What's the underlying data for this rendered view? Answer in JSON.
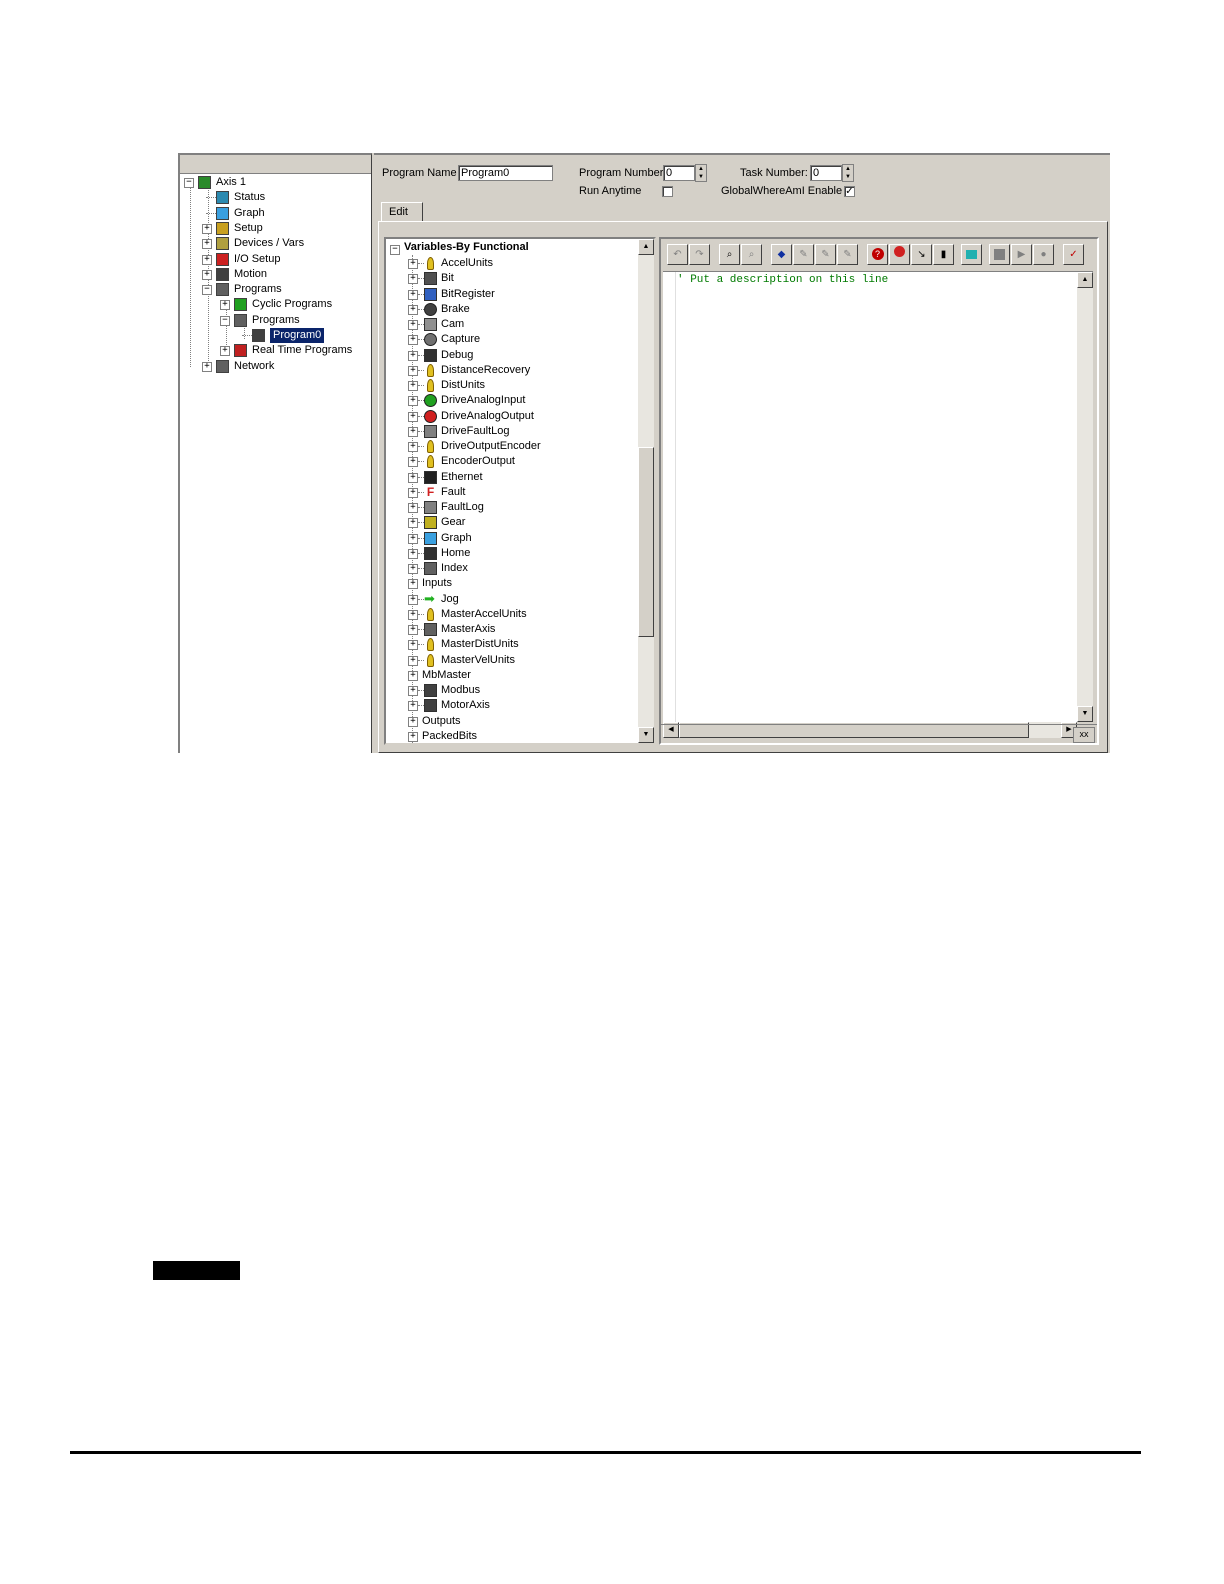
{
  "nav": {
    "items": [
      {
        "label": "Axis 1",
        "icon": "drive-icon",
        "expander": "−"
      },
      {
        "label": "Status",
        "icon": "status-icon",
        "expander": ""
      },
      {
        "label": "Graph",
        "icon": "graph-icon",
        "expander": ""
      },
      {
        "label": "Setup",
        "icon": "setup-icon",
        "expander": "+"
      },
      {
        "label": "Devices / Vars",
        "icon": "devices-icon",
        "expander": "+"
      },
      {
        "label": "I/O Setup",
        "icon": "io-setup-icon",
        "expander": "+"
      },
      {
        "label": "Motion",
        "icon": "motion-icon",
        "expander": "+"
      },
      {
        "label": "Programs",
        "icon": "programs-icon",
        "expander": "−"
      },
      {
        "label": "Cyclic Programs",
        "icon": "cyclic-programs-icon",
        "expander": "+"
      },
      {
        "label": "Programs",
        "icon": "programs-icon",
        "expander": "−"
      },
      {
        "label": "Program0",
        "icon": "program-icon",
        "expander": ""
      },
      {
        "label": "Real Time Programs",
        "icon": "realtime-programs-icon",
        "expander": "+"
      },
      {
        "label": "Network",
        "icon": "network-icon",
        "expander": "+"
      }
    ]
  },
  "form": {
    "program_name_label": "Program Name",
    "program_name_value": "Program0",
    "program_number_label": "Program Number",
    "program_number_value": "0",
    "task_number_label": "Task Number:",
    "task_number_value": "0",
    "run_anytime_label": "Run Anytime",
    "run_anytime_checked": false,
    "global_whereami_label": "GlobalWhereAmI Enable",
    "global_whereami_checked": true,
    "checkmark": "✓"
  },
  "tab": {
    "label": "Edit"
  },
  "vars": {
    "root_label": "Variables-By Functional",
    "items": [
      {
        "label": "AccelUnits",
        "icon": "pin-icon"
      },
      {
        "label": "Bit",
        "icon": "user-bit-icon"
      },
      {
        "label": "BitRegister",
        "icon": "user-register-icon"
      },
      {
        "label": "Brake",
        "icon": "brake-icon"
      },
      {
        "label": "Cam",
        "icon": "cam-icon"
      },
      {
        "label": "Capture",
        "icon": "capture-icon"
      },
      {
        "label": "Debug",
        "icon": "debug-icon"
      },
      {
        "label": "DistanceRecovery",
        "icon": "pin-icon"
      },
      {
        "label": "DistUnits",
        "icon": "pin-icon"
      },
      {
        "label": "DriveAnalogInput",
        "icon": "analog-input-icon"
      },
      {
        "label": "DriveAnalogOutput",
        "icon": "analog-output-icon"
      },
      {
        "label": "DriveFaultLog",
        "icon": "faultlog-icon"
      },
      {
        "label": "DriveOutputEncoder",
        "icon": "pin-icon"
      },
      {
        "label": "EncoderOutput",
        "icon": "pin-icon"
      },
      {
        "label": "Ethernet",
        "icon": "ethernet-icon"
      },
      {
        "label": "Fault",
        "icon": "fault-icon"
      },
      {
        "label": "FaultLog",
        "icon": "faultlog-icon"
      },
      {
        "label": "Gear",
        "icon": "gear-icon"
      },
      {
        "label": "Graph",
        "icon": "graph-icon"
      },
      {
        "label": "Home",
        "icon": "home-icon"
      },
      {
        "label": "Index",
        "icon": "index-icon"
      },
      {
        "label": "Inputs",
        "icon": ""
      },
      {
        "label": "Jog",
        "icon": "jog-arrow-icon"
      },
      {
        "label": "MasterAccelUnits",
        "icon": "pin-icon"
      },
      {
        "label": "MasterAxis",
        "icon": "master-axis-icon"
      },
      {
        "label": "MasterDistUnits",
        "icon": "pin-icon"
      },
      {
        "label": "MasterVelUnits",
        "icon": "pin-icon"
      },
      {
        "label": "MbMaster",
        "icon": ""
      },
      {
        "label": "Modbus",
        "icon": "modbus-icon"
      },
      {
        "label": "MotorAxis",
        "icon": "motor-axis-icon"
      },
      {
        "label": "Outputs",
        "icon": ""
      },
      {
        "label": "PackedBits",
        "icon": ""
      }
    ]
  },
  "editor": {
    "code_line": "' Put a description on this line",
    "status_box": "xx"
  },
  "colors": {
    "selection": "#0a246a",
    "code_comment": "#007a00",
    "window_face": "#d4d0c8"
  }
}
